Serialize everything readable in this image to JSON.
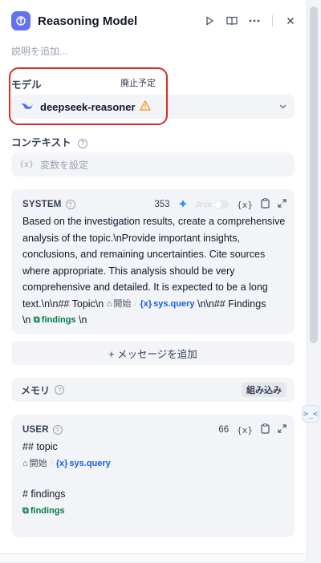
{
  "header": {
    "title": "Reasoning Model",
    "description_placeholder": "説明を追加..."
  },
  "model": {
    "label": "モデル",
    "deprecated_badge": "廃止予定",
    "name": "deepseek-reasoner"
  },
  "context": {
    "label": "コンテキスト",
    "placeholder": "変数を設定"
  },
  "system_prompt": {
    "role": "SYSTEM",
    "tokens": "353",
    "jinja_label": "Jinja",
    "text_1": "Based on the investigation results, create a comprehensive analysis of the topic.\\nProvide important insights, conclusions, and remaining uncertainties. Cite sources where appropriate. This analysis should be very comprehensive and detailed. It is expected to be a long text.\\n\\n## Topic\\n",
    "var1_node": "開始",
    "var1_name": "sys.query",
    "text_2": "\\n\\n## Findings",
    "text_3": "\\n",
    "var2_name": "findings",
    "text_4": "\\n"
  },
  "add_message": {
    "label": "+ メッセージを追加"
  },
  "memory": {
    "label": "メモリ",
    "builtin_button": "組み込み"
  },
  "user_prompt": {
    "role": "USER",
    "tokens": "66",
    "line_1": "## topic",
    "var1_node": "開始",
    "var1_name": "sys.query",
    "line_2": "# findings",
    "var2_name": "findings"
  },
  "icons": {
    "var_icon": "{x}",
    "side_handle": ">_<"
  },
  "colors": {
    "accent": "#155eef",
    "app_icon": "#6172f3",
    "highlight": "#d92d20",
    "warning": "#f79009",
    "node_var": "#027a48"
  }
}
